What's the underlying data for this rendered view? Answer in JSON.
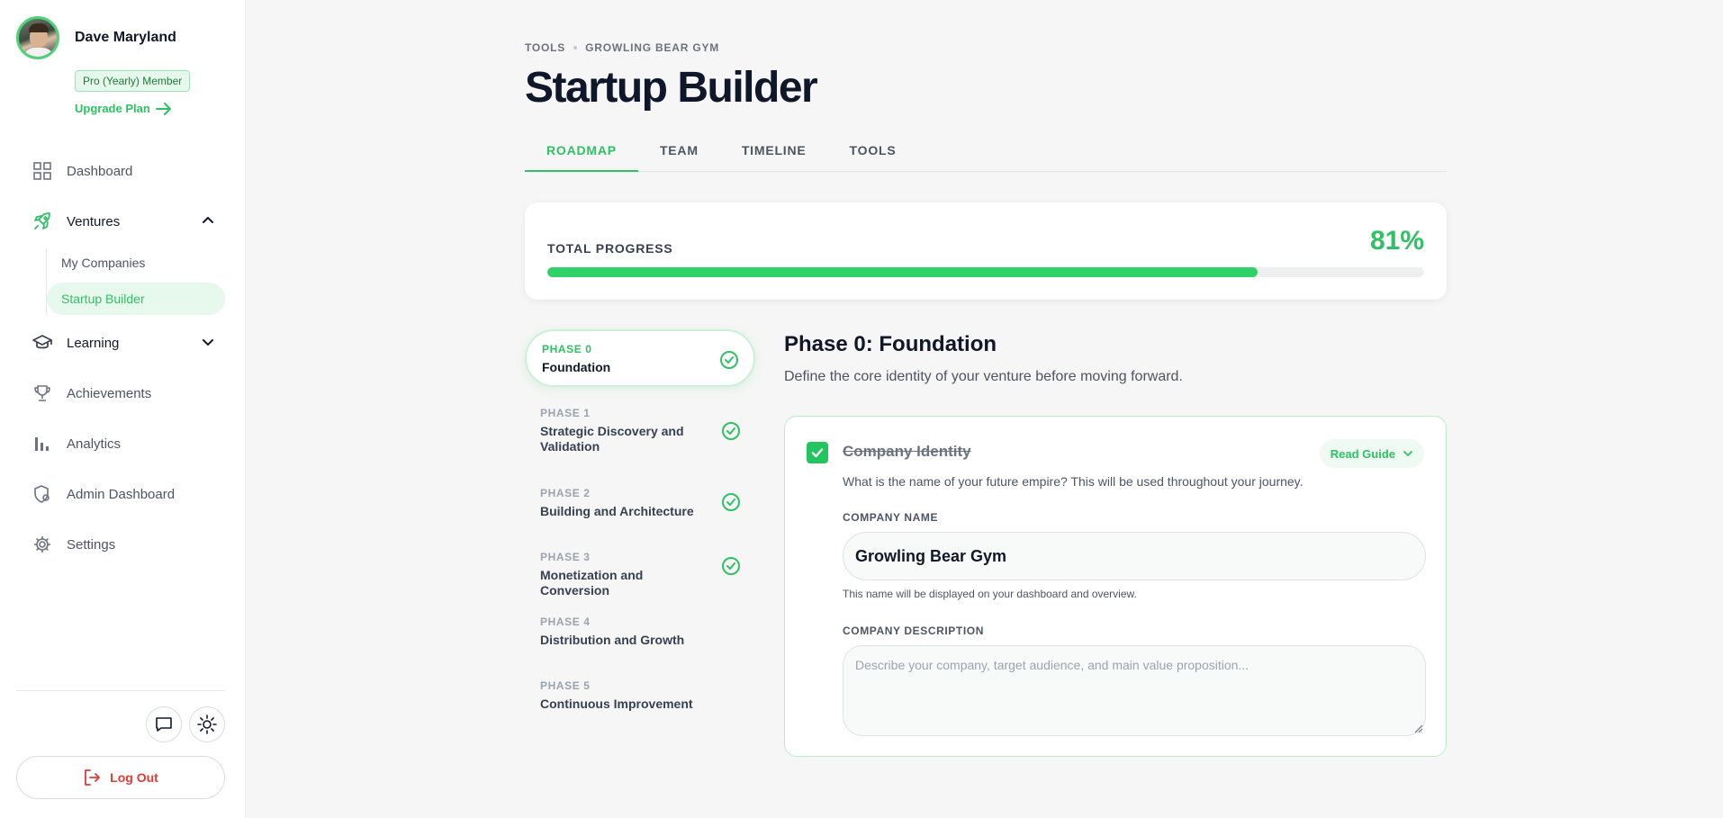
{
  "user": {
    "name": "Dave Maryland",
    "membership": "Pro (Yearly) Member",
    "upgrade_label": "Upgrade Plan"
  },
  "sidebar": {
    "items": [
      {
        "label": "Dashboard",
        "icon": "grid-icon"
      },
      {
        "label": "Ventures",
        "icon": "rocket-icon",
        "expanded": true,
        "children": [
          {
            "label": "My Companies"
          },
          {
            "label": "Startup Builder",
            "active": true
          }
        ]
      },
      {
        "label": "Learning",
        "icon": "graduation-cap-icon",
        "expanded": false
      },
      {
        "label": "Achievements",
        "icon": "trophy-icon"
      },
      {
        "label": "Analytics",
        "icon": "bar-chart-icon"
      },
      {
        "label": "Admin Dashboard",
        "icon": "shield-gear-icon"
      },
      {
        "label": "Settings",
        "icon": "gear-icon"
      }
    ],
    "logout_label": "Log Out"
  },
  "breadcrumb": [
    "TOOLS",
    "GROWLING BEAR GYM"
  ],
  "page_title": "Startup Builder",
  "tabs": [
    {
      "label": "ROADMAP",
      "active": true
    },
    {
      "label": "TEAM"
    },
    {
      "label": "TIMELINE"
    },
    {
      "label": "TOOLS"
    }
  ],
  "progress": {
    "label": "TOTAL PROGRESS",
    "value_text": "81%",
    "value": 0.81
  },
  "phases": [
    {
      "num": "PHASE 0",
      "name": "Foundation",
      "complete": true,
      "active": true
    },
    {
      "num": "PHASE 1",
      "name": "Strategic Discovery and Validation",
      "complete": true
    },
    {
      "num": "PHASE 2",
      "name": "Building and Architecture",
      "complete": true
    },
    {
      "num": "PHASE 3",
      "name": "Monetization and Conversion",
      "complete": true
    },
    {
      "num": "PHASE 4",
      "name": "Distribution and Growth",
      "complete": false
    },
    {
      "num": "PHASE 5",
      "name": "Continuous Improvement",
      "complete": false
    }
  ],
  "detail": {
    "title": "Phase 0: Foundation",
    "subtitle": "Define the core identity of your venture before moving forward.",
    "task": {
      "title": "Company Identity",
      "completed": true,
      "read_guide": "Read Guide",
      "description": "What is the name of your future empire? This will be used throughout your journey.",
      "name_label": "COMPANY NAME",
      "name_value": "Growling Bear Gym",
      "name_hint": "This name will be displayed on your dashboard and overview.",
      "desc_label": "COMPANY DESCRIPTION",
      "desc_placeholder": "Describe your company, target audience, and main value proposition..."
    }
  },
  "colors": {
    "accent": "#2ec264",
    "danger": "#e53935",
    "text": "#111827"
  }
}
